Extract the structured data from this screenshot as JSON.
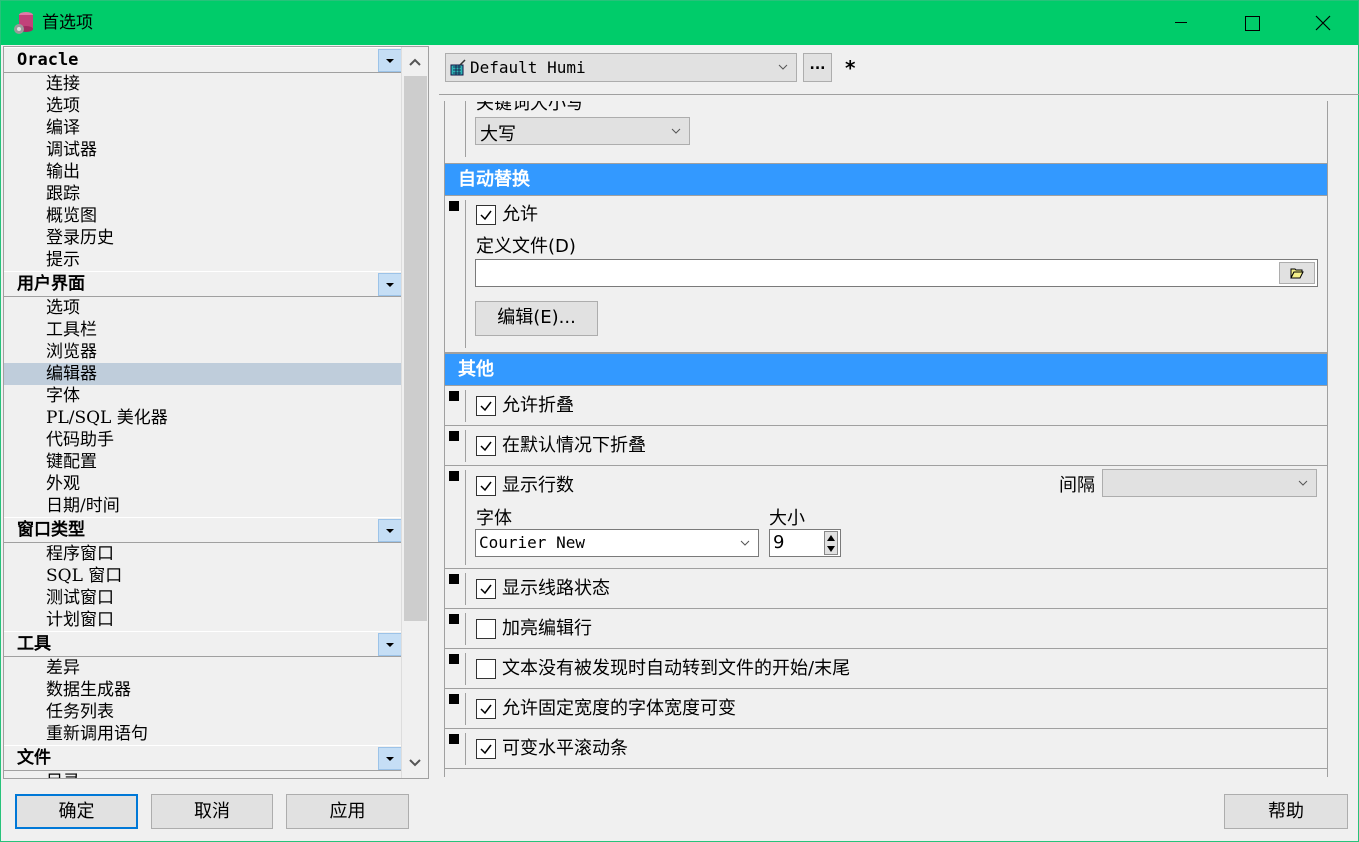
{
  "window": {
    "title": "首选项",
    "controls": {
      "minimize": "minimize",
      "maximize": "maximize",
      "close": "close"
    }
  },
  "nav": {
    "groups": [
      {
        "label": "Oracle",
        "items": [
          "连接",
          "选项",
          "编译",
          "调试器",
          "输出",
          "跟踪",
          "概览图",
          "登录历史",
          "提示"
        ]
      },
      {
        "label": "用户界面",
        "items": [
          "选项",
          "工具栏",
          "浏览器",
          "编辑器",
          "字体",
          "PL/SQL 美化器",
          "代码助手",
          "键配置",
          "外观",
          "日期/时间"
        ]
      },
      {
        "label": "窗口类型",
        "items": [
          "程序窗口",
          "SQL 窗口",
          "测试窗口",
          "计划窗口"
        ]
      },
      {
        "label": "工具",
        "items": [
          "差异",
          "数据生成器",
          "任务列表",
          "重新调用语句"
        ]
      },
      {
        "label": "文件",
        "items": [
          "目录"
        ]
      }
    ],
    "selected": "编辑器"
  },
  "profile": {
    "value": "Default Humi",
    "more_label": "...",
    "modified_marker": "*"
  },
  "editor": {
    "keyword_case": {
      "label": "关键词大小写",
      "value": "大写"
    },
    "autoreplace": {
      "header": "自动替换",
      "enable": {
        "label": "允许",
        "checked": true
      },
      "def_file_label": "定义文件(D)",
      "def_file_value": "",
      "edit_button": "编辑(E)..."
    },
    "other": {
      "header": "其他",
      "allow_folding": {
        "label": "允许折叠",
        "checked": true
      },
      "fold_default": {
        "label": "在默认情况下折叠",
        "checked": true
      },
      "show_line_numbers": {
        "label": "显示行数",
        "checked": true,
        "interval_label": "间隔",
        "interval_value": "",
        "font_label": "字体",
        "font_value": "Courier New",
        "size_label": "大小",
        "size_value": "9"
      },
      "show_connection_status": {
        "label": "显示线路状态",
        "checked": true
      },
      "highlight_edit_line": {
        "label": "加亮编辑行",
        "checked": false
      },
      "wrap_search": {
        "label": "文本没有被发现时自动转到文件的开始/末尾",
        "checked": false
      },
      "variable_fixed_width": {
        "label": "允许固定宽度的字体宽度可变",
        "checked": true
      },
      "variable_hscroll": {
        "label": "可变水平滚动条",
        "checked": true
      }
    }
  },
  "footer": {
    "ok": "确定",
    "cancel": "取消",
    "apply": "应用",
    "help": "帮助"
  },
  "colors": {
    "titlebar": "#00cc6a",
    "section_header": "#3399ff",
    "selected_item": "#bfcddb"
  }
}
